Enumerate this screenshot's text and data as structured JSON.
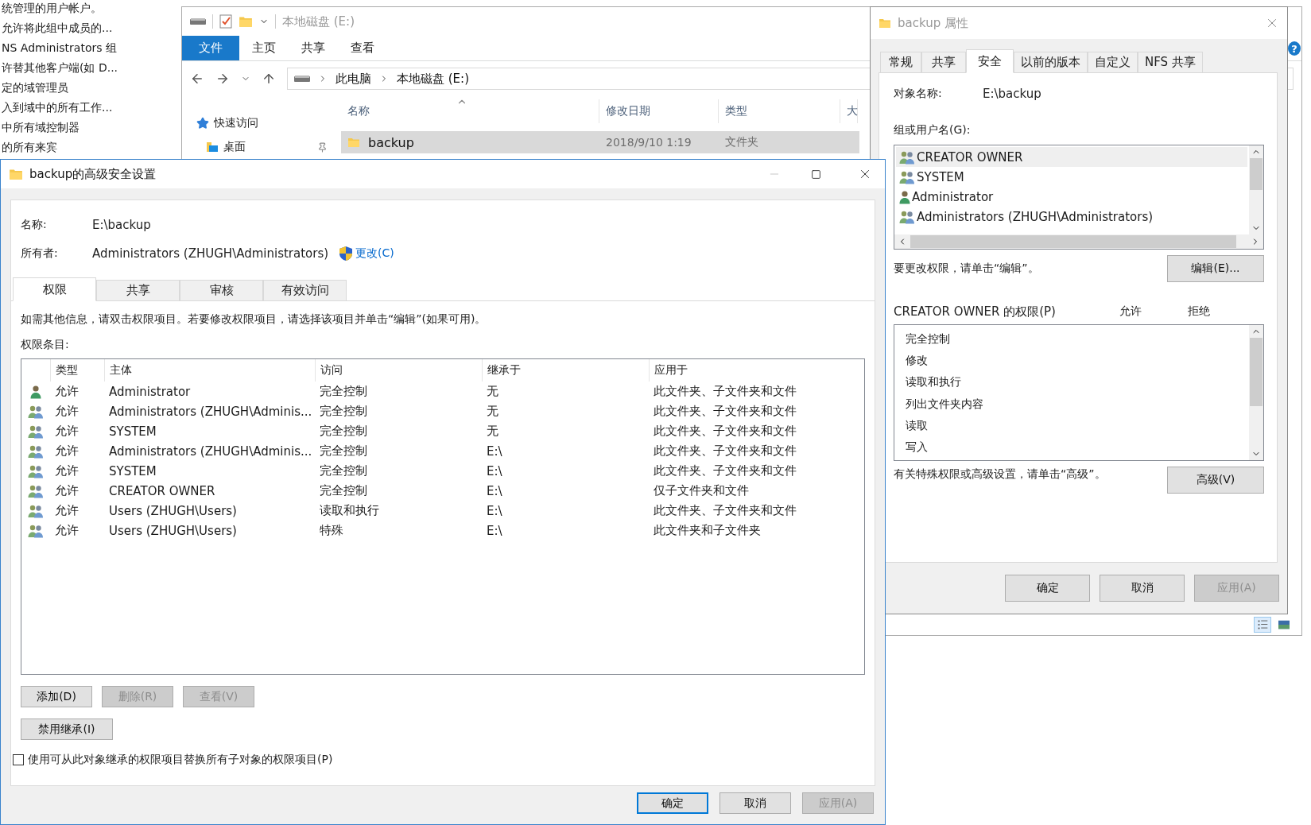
{
  "background_list": {
    "items": [
      "统管理的用户帐户。",
      "允许将此组中成员的...",
      "NS Administrators 组",
      "许替其他客户端(如 D...",
      "定的域管理员",
      "入到域中的所有工作...",
      "中所有域控制器",
      "的所有来宾"
    ]
  },
  "explorer": {
    "title": "本地磁盘 (E:)",
    "ribbon_tabs": [
      {
        "label": "文件",
        "selected": true
      },
      {
        "label": "主页",
        "selected": false
      },
      {
        "label": "共享",
        "selected": false
      },
      {
        "label": "查看",
        "selected": false
      }
    ],
    "help": "?",
    "breadcrumb": [
      "此电脑",
      "本地磁盘 (E:)"
    ],
    "nav_items": [
      {
        "label": "快速访问",
        "kind": "star"
      },
      {
        "label": "桌面",
        "kind": "desktop"
      }
    ],
    "columns": [
      "名称",
      "修改日期",
      "类型",
      "大"
    ],
    "rows": [
      {
        "name": "backup",
        "modified": "2018/9/10 1:19",
        "type": "文件夹",
        "selected": true
      }
    ]
  },
  "properties": {
    "title": "backup 属性",
    "tabs": [
      {
        "label": "常规",
        "selected": false
      },
      {
        "label": "共享",
        "selected": false
      },
      {
        "label": "安全",
        "selected": true
      },
      {
        "label": "以前的版本",
        "selected": false
      },
      {
        "label": "自定义",
        "selected": false
      },
      {
        "label": "NFS 共享",
        "selected": false
      }
    ],
    "object_label": "对象名称:",
    "object_value": "E:\\backup",
    "groups_label": "组或用户名(G):",
    "groups": [
      {
        "name": "CREATOR OWNER",
        "kind": "group",
        "selected": true
      },
      {
        "name": "SYSTEM",
        "kind": "group",
        "selected": false
      },
      {
        "name": "Administrator",
        "kind": "user",
        "selected": false
      },
      {
        "name": "Administrators (ZHUGH\\Administrators)",
        "kind": "group",
        "selected": false
      }
    ],
    "edit_hint": "要更改权限，请单击“编辑”。",
    "edit_button": "编辑(E)...",
    "perm_label": "CREATOR OWNER 的权限(P)",
    "allow_header": "允许",
    "deny_header": "拒绝",
    "permissions": [
      "完全控制",
      "修改",
      "读取和执行",
      "列出文件夹内容",
      "读取",
      "写入"
    ],
    "advanced_hint": "有关特殊权限或高级设置，请单击“高级”。",
    "advanced_button": "高级(V)",
    "buttons": [
      {
        "label": "确定",
        "disabled": false
      },
      {
        "label": "取消",
        "disabled": false
      },
      {
        "label": "应用(A)",
        "disabled": true
      }
    ]
  },
  "advanced": {
    "title": "backup的高级安全设置",
    "name_label": "名称:",
    "name_value": "E:\\backup",
    "owner_label": "所有者:",
    "owner_value": "Administrators (ZHUGH\\Administrators)",
    "change_link": "更改(C)",
    "tabs": [
      {
        "label": "权限",
        "selected": true
      },
      {
        "label": "共享",
        "selected": false
      },
      {
        "label": "审核",
        "selected": false
      },
      {
        "label": "有效访问",
        "selected": false
      }
    ],
    "info": "如需其他信息，请双击权限项目。若要修改权限项目，请选择该项目并单击“编辑”(如果可用)。",
    "entries_label": "权限条目:",
    "columns": [
      "类型",
      "主体",
      "访问",
      "继承于",
      "应用于"
    ],
    "rows": [
      {
        "kind": "user",
        "type": "允许",
        "principal": "Administrator",
        "access": "完全控制",
        "inherited_from": "无",
        "applies_to": "此文件夹、子文件夹和文件"
      },
      {
        "kind": "group",
        "type": "允许",
        "principal": "Administrators (ZHUGH\\Adminis...",
        "access": "完全控制",
        "inherited_from": "无",
        "applies_to": "此文件夹、子文件夹和文件"
      },
      {
        "kind": "group",
        "type": "允许",
        "principal": "SYSTEM",
        "access": "完全控制",
        "inherited_from": "无",
        "applies_to": "此文件夹、子文件夹和文件"
      },
      {
        "kind": "group",
        "type": "允许",
        "principal": "Administrators (ZHUGH\\Adminis...",
        "access": "完全控制",
        "inherited_from": "E:\\",
        "applies_to": "此文件夹、子文件夹和文件"
      },
      {
        "kind": "group",
        "type": "允许",
        "principal": "SYSTEM",
        "access": "完全控制",
        "inherited_from": "E:\\",
        "applies_to": "此文件夹、子文件夹和文件"
      },
      {
        "kind": "group",
        "type": "允许",
        "principal": "CREATOR OWNER",
        "access": "完全控制",
        "inherited_from": "E:\\",
        "applies_to": "仅子文件夹和文件"
      },
      {
        "kind": "group",
        "type": "允许",
        "principal": "Users (ZHUGH\\Users)",
        "access": "读取和执行",
        "inherited_from": "E:\\",
        "applies_to": "此文件夹、子文件夹和文件"
      },
      {
        "kind": "group",
        "type": "允许",
        "principal": "Users (ZHUGH\\Users)",
        "access": "特殊",
        "inherited_from": "E:\\",
        "applies_to": "此文件夹和子文件夹"
      }
    ],
    "buttons": [
      {
        "label": "添加(D)",
        "disabled": false
      },
      {
        "label": "删除(R)",
        "disabled": true
      },
      {
        "label": "查看(V)",
        "disabled": true
      }
    ],
    "inheritance_button": "禁用继承(I)",
    "replace_checkbox": {
      "label": "使用可从此对象继承的权限项目替换所有子对象的权限项目(P)",
      "checked": false
    },
    "dialog_buttons": [
      {
        "label": "确定",
        "disabled": false,
        "focused": true
      },
      {
        "label": "取消",
        "disabled": false,
        "focused": false
      },
      {
        "label": "应用(A)",
        "disabled": true,
        "focused": false
      }
    ]
  }
}
